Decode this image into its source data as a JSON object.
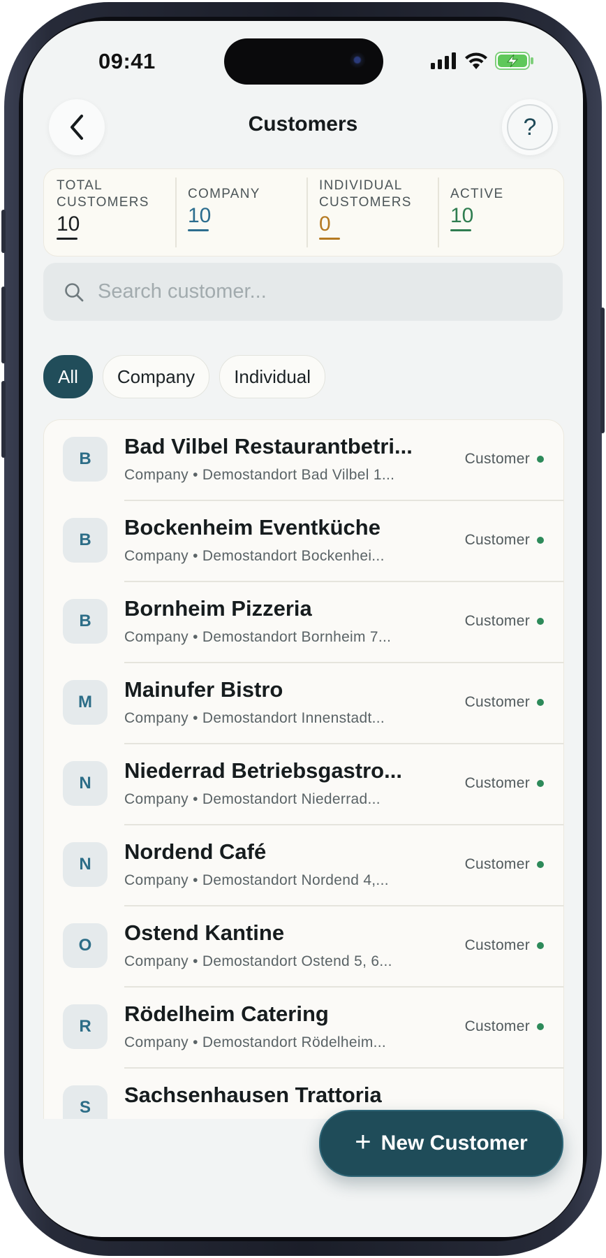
{
  "status_bar": {
    "time": "09:41"
  },
  "header": {
    "title": "Customers",
    "help_label": "?"
  },
  "stats": [
    {
      "label": "Total Customers",
      "value": "10",
      "color": "#1b1f21"
    },
    {
      "label": "Company",
      "value": "10",
      "color": "#2c6d8e"
    },
    {
      "label": "Individual Customers",
      "value": "0",
      "color": "#b57a22"
    },
    {
      "label": "Active",
      "value": "10",
      "color": "#2f7d50"
    }
  ],
  "search": {
    "placeholder": "Search customer..."
  },
  "filters": [
    {
      "label": "All",
      "active": true
    },
    {
      "label": "Company",
      "active": false
    },
    {
      "label": "Individual",
      "active": false
    }
  ],
  "customers": [
    {
      "initial": "B",
      "name": "Bad Vilbel Restaurantbetri...",
      "subtitle": "Company • Demostandort Bad Vilbel 1...",
      "status": "Customer"
    },
    {
      "initial": "B",
      "name": "Bockenheim Eventküche",
      "subtitle": "Company • Demostandort Bockenhei...",
      "status": "Customer"
    },
    {
      "initial": "B",
      "name": "Bornheim Pizzeria",
      "subtitle": "Company • Demostandort Bornheim 7...",
      "status": "Customer"
    },
    {
      "initial": "M",
      "name": "Mainufer Bistro",
      "subtitle": "Company • Demostandort Innenstadt...",
      "status": "Customer"
    },
    {
      "initial": "N",
      "name": "Niederrad Betriebsgastro...",
      "subtitle": "Company • Demostandort Niederrad...",
      "status": "Customer"
    },
    {
      "initial": "N",
      "name": "Nordend Café",
      "subtitle": "Company • Demostandort Nordend 4,...",
      "status": "Customer"
    },
    {
      "initial": "O",
      "name": "Ostend Kantine",
      "subtitle": "Company • Demostandort Ostend 5, 6...",
      "status": "Customer"
    },
    {
      "initial": "R",
      "name": "Rödelheim Catering",
      "subtitle": "Company • Demostandort Rödelheim...",
      "status": "Customer"
    },
    {
      "initial": "S",
      "name": "Sachsenhausen Trattoria",
      "subtitle": "",
      "status": ""
    }
  ],
  "fab": {
    "label": "New Customer",
    "icon": "plus-icon"
  }
}
